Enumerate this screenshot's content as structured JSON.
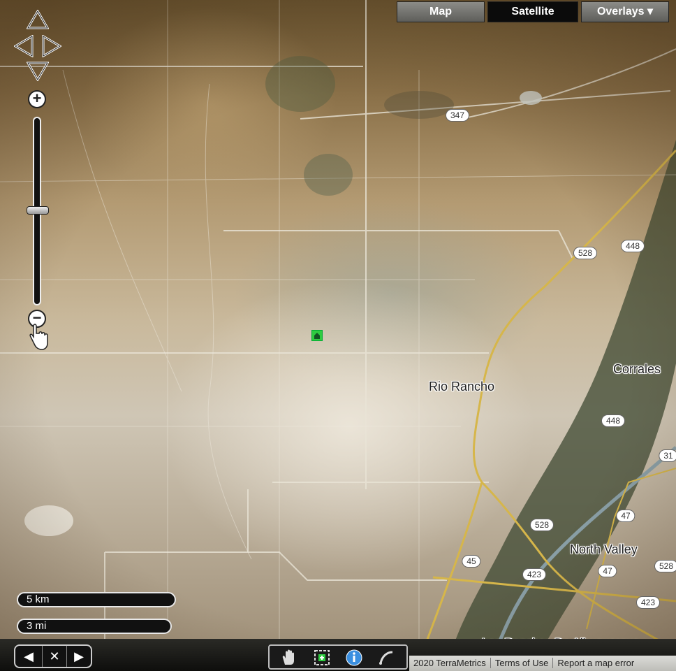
{
  "map_type_controls": {
    "map_label": "Map",
    "satellite_label": "Satellite",
    "overlays_label": "Overlays ▾",
    "active": "Satellite"
  },
  "zoom": {
    "in_symbol": "+",
    "out_symbol": "−",
    "level_fraction": 0.5
  },
  "places": [
    {
      "key": "rio_rancho",
      "label": "Rio Rancho"
    },
    {
      "key": "corrales",
      "label": "Corrales"
    },
    {
      "key": "north_valley",
      "label": "North Valley"
    },
    {
      "key": "los_ranchos",
      "label": "Los Ranchos De Albuquerque"
    }
  ],
  "route_shields": [
    "347",
    "528",
    "448",
    "448",
    "528",
    "47",
    "47",
    "45",
    "423",
    "423",
    "528",
    "31"
  ],
  "scale": {
    "metric": "5 km",
    "imperial": "3 mi"
  },
  "bottom_nav": {
    "prev_symbol": "◀",
    "center_symbol": "✕",
    "next_symbol": "▶"
  },
  "tools": [
    "pan-hand-icon",
    "add-location-icon",
    "info-icon",
    "measure-icon"
  ],
  "copyright": {
    "attribution": "2020 TerraMetrics",
    "terms": "Terms of Use",
    "report": "Report a map error"
  },
  "colors": {
    "road": "#e9e4d6",
    "highway": "#d6b64a",
    "river": "#8aa0a8",
    "marker": "#2ecc40"
  }
}
